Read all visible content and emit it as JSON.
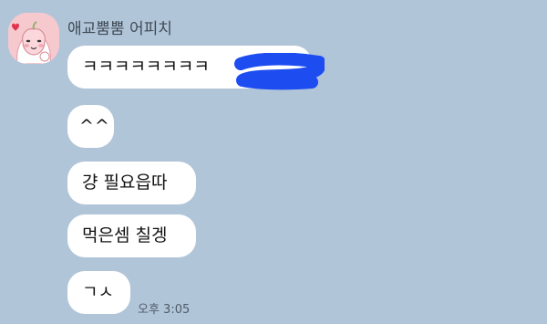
{
  "chat": {
    "sender_name": "애교뿜뿜 어피치",
    "avatar_icon": "apeach-character-avatar-icon",
    "redaction_color": "#1d4cf1",
    "messages": [
      {
        "text": "ㅋㅋㅋㅋㅋㅋㅋㅋ"
      },
      {
        "text": "^^"
      },
      {
        "text": "걍 필요읍따"
      },
      {
        "text": "먹은셈 칠겡"
      },
      {
        "text": "ㄱㅅ"
      }
    ],
    "timestamp": "오후 3:05"
  },
  "colors": {
    "background": "#b1c5d9",
    "bubble": "#ffffff",
    "avatar_bg": "#f6c9cf"
  }
}
